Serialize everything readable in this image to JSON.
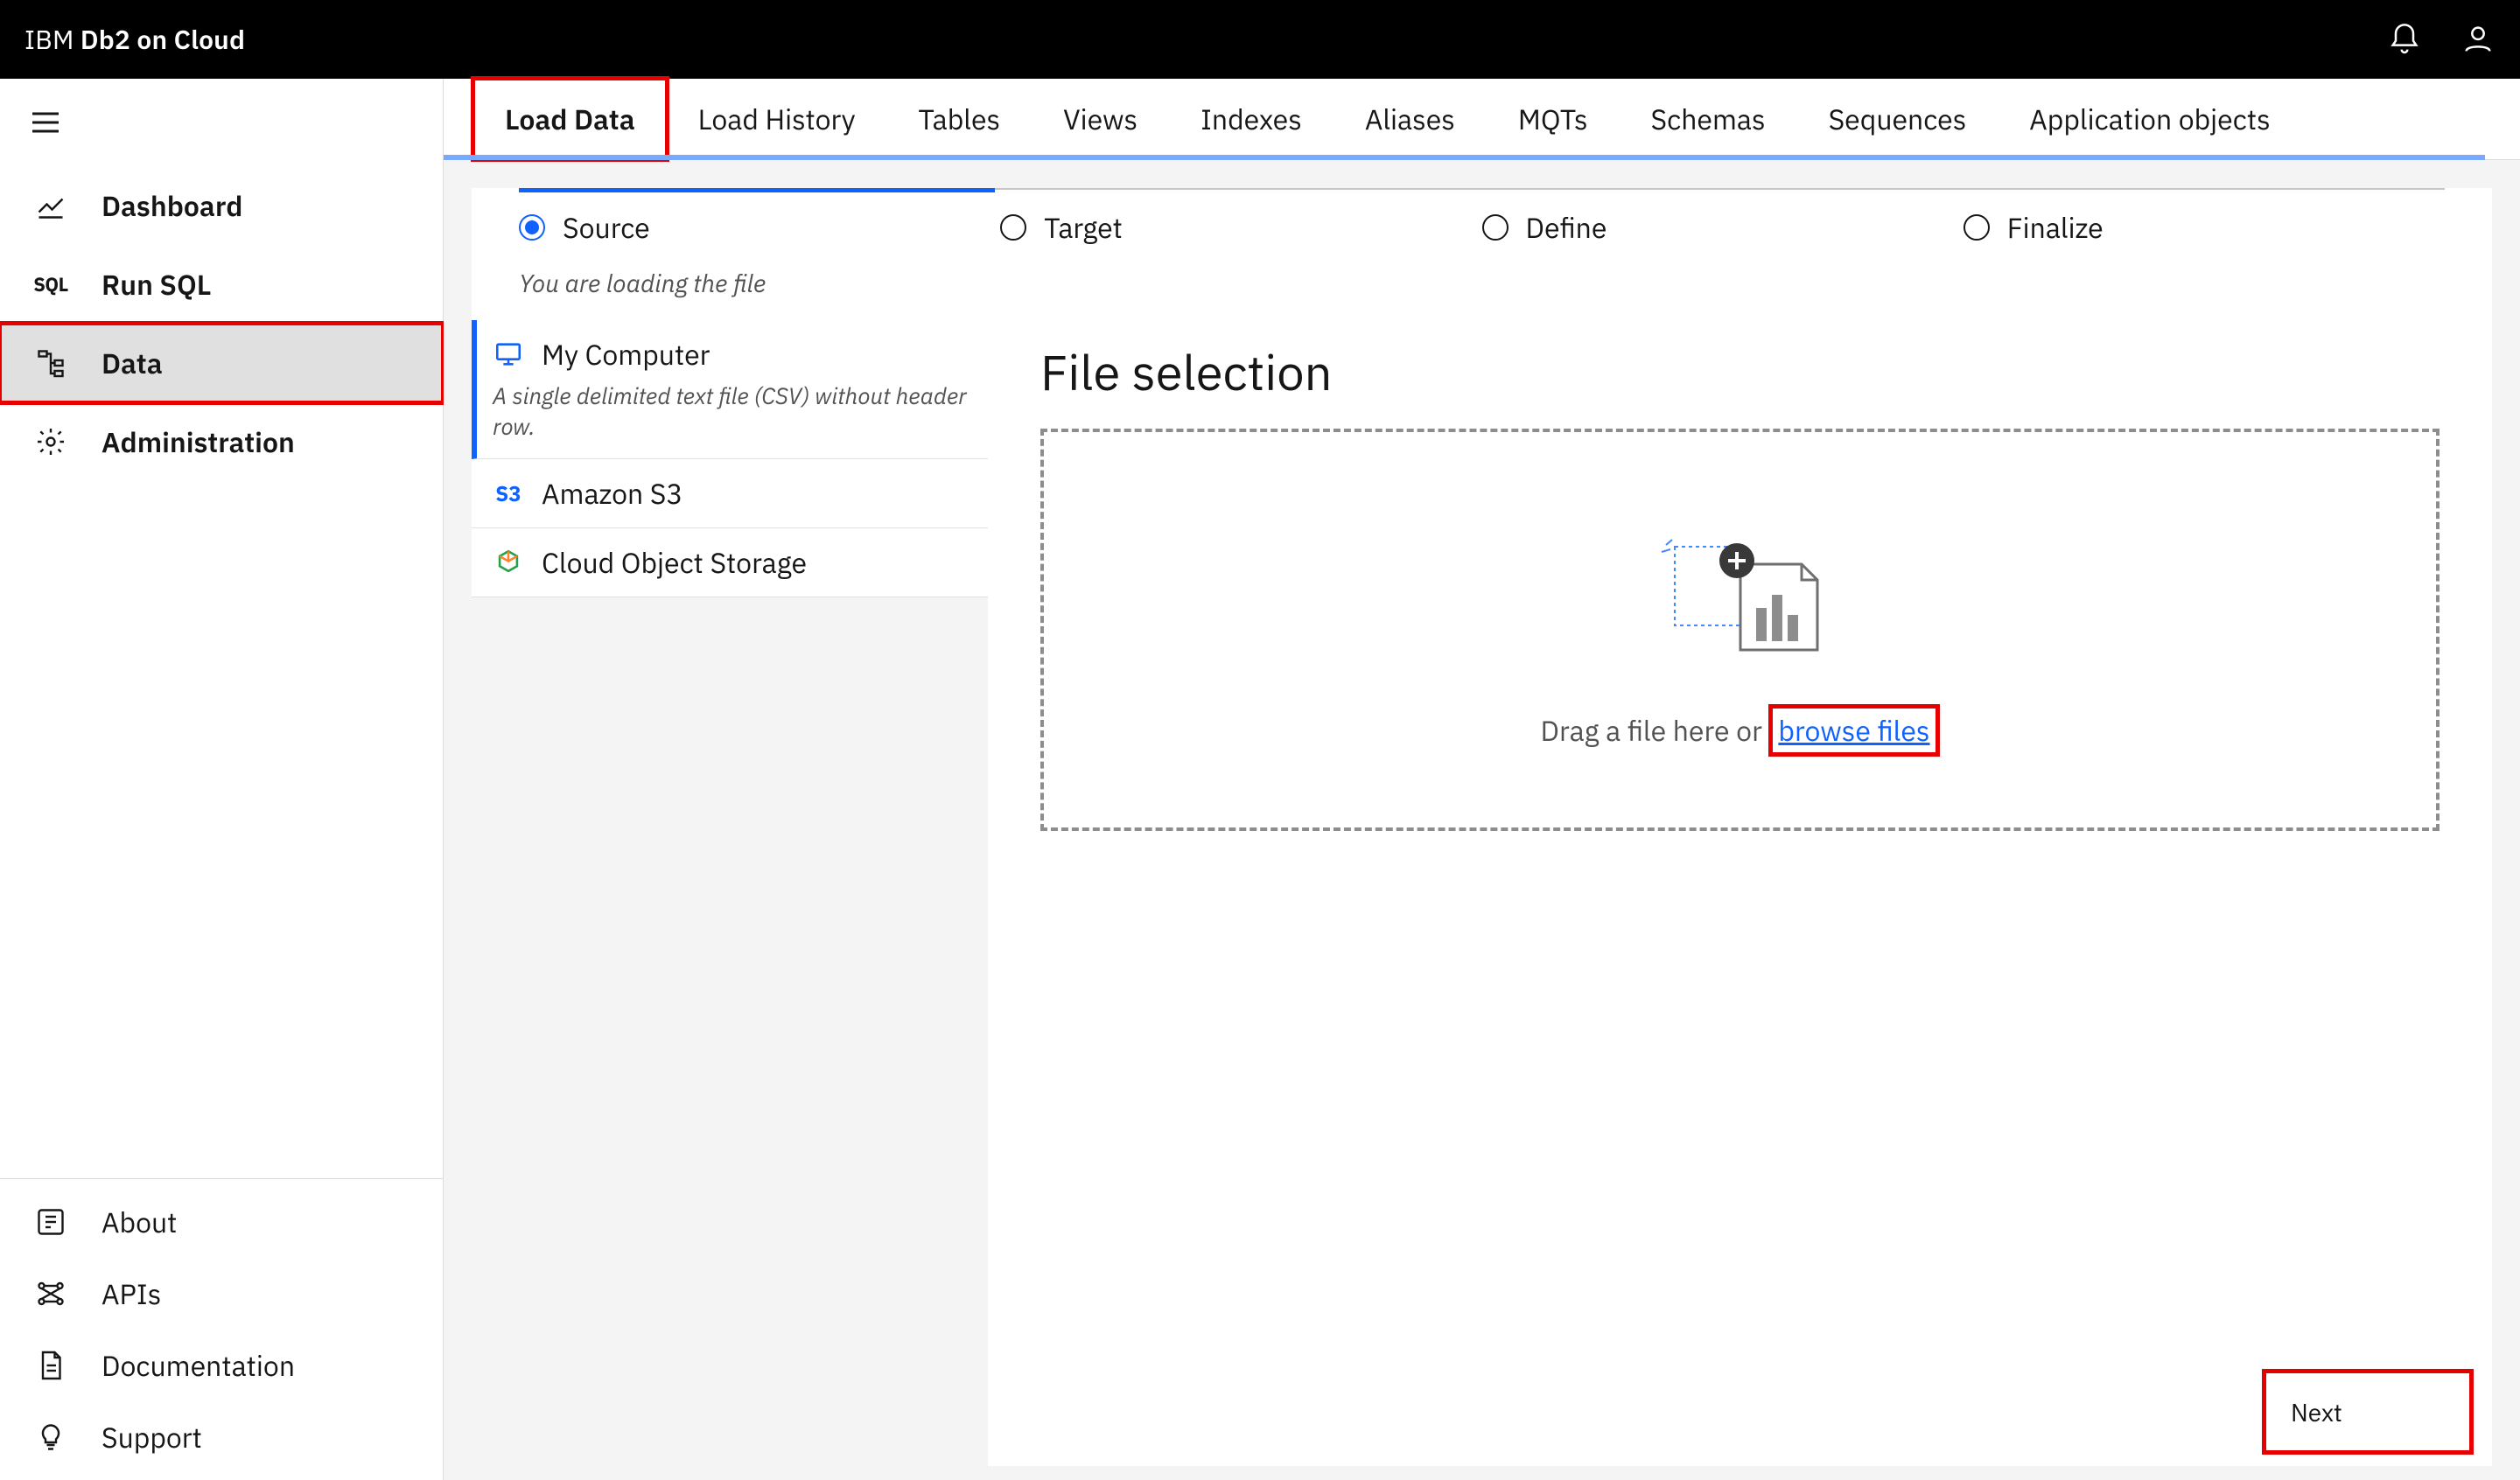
{
  "header": {
    "brand_prefix": "IBM",
    "brand_product": "Db2 on Cloud"
  },
  "sidebar": {
    "items": [
      {
        "icon": "chart-line-icon",
        "label": "Dashboard"
      },
      {
        "icon": "sql-icon",
        "label": "Run SQL",
        "icon_text": "SQL"
      },
      {
        "icon": "tree-icon",
        "label": "Data"
      },
      {
        "icon": "gear-icon",
        "label": "Administration"
      }
    ],
    "bottom": [
      {
        "icon": "info-icon",
        "label": "About"
      },
      {
        "icon": "graph-icon",
        "label": "APIs"
      },
      {
        "icon": "document-icon",
        "label": "Documentation"
      },
      {
        "icon": "idea-icon",
        "label": "Support"
      }
    ]
  },
  "tabs": {
    "items": [
      "Load Data",
      "Load History",
      "Tables",
      "Views",
      "Indexes",
      "Aliases",
      "MQTs",
      "Schemas",
      "Sequences",
      "Application objects"
    ],
    "active_index": 0
  },
  "stepper": {
    "steps": [
      "Source",
      "Target",
      "Define",
      "Finalize"
    ],
    "active_index": 0,
    "subtext": "You are loading the file"
  },
  "sources": {
    "items": [
      {
        "label": "My Computer",
        "desc": "A single delimited text file (CSV) without header row.",
        "icon": "monitor-icon"
      },
      {
        "label": "Amazon S3",
        "icon": "s3-icon",
        "icon_text": "S3"
      },
      {
        "label": "Cloud Object Storage",
        "icon": "cloud-cube-icon"
      }
    ],
    "active_index": 0
  },
  "file_area": {
    "title": "File selection",
    "drop_prefix": "Drag a file here or ",
    "browse_link": "browse files"
  },
  "actions": {
    "next": "Next"
  }
}
